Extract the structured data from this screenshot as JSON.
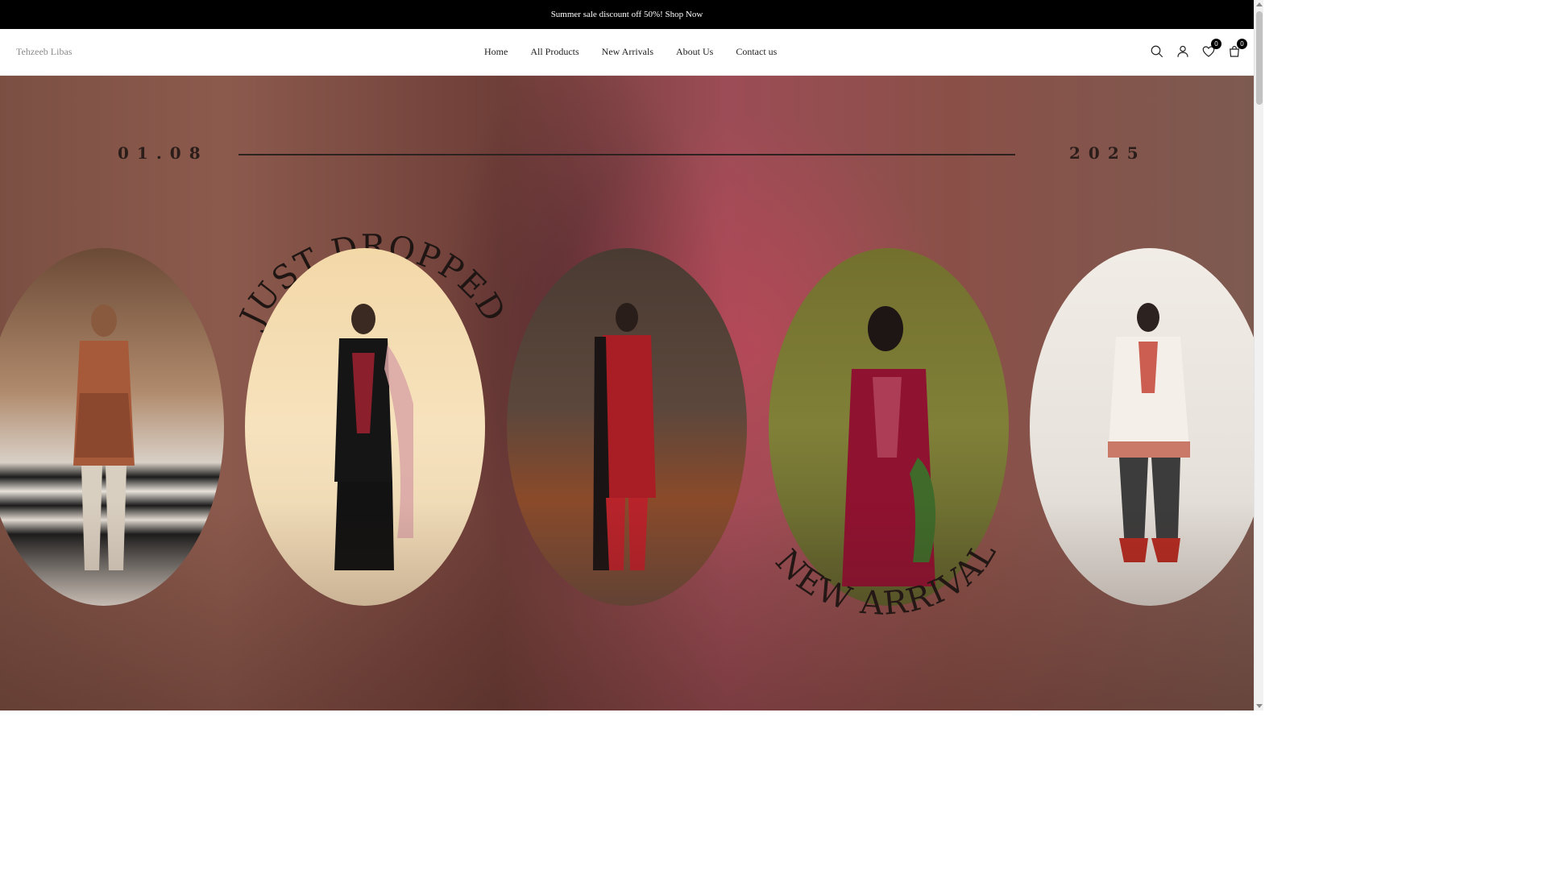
{
  "announcement": {
    "text": "Summer sale discount off 50%! Shop Now"
  },
  "header": {
    "logo": "Tehzeeb Libas",
    "nav": [
      {
        "label": "Home"
      },
      {
        "label": "All Products"
      },
      {
        "label": "New Arrivals"
      },
      {
        "label": "About Us"
      },
      {
        "label": "Contact us"
      }
    ],
    "icons": {
      "search": "search-icon",
      "account": "user-icon",
      "wishlist": "heart-icon",
      "cart": "shopping-bag-icon"
    },
    "wishlist_count": "0",
    "cart_count": "0"
  },
  "hero": {
    "date_left": "01.08",
    "date_right": "2025",
    "headline_top": "JUST DROPPED",
    "headline_bottom": "NEW ARRIVALS",
    "colors": {
      "background": "#8a5048",
      "text": "#1f1614"
    }
  }
}
